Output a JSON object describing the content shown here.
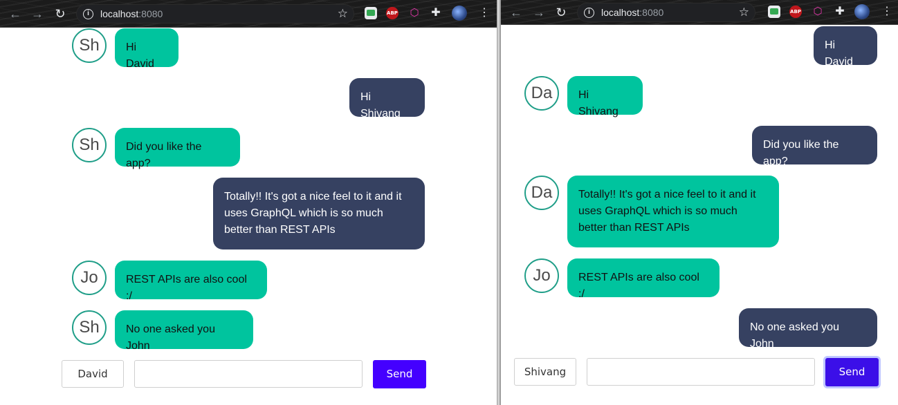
{
  "left_window": {
    "url_host": "localhost",
    "url_port": ":8080",
    "messages": [
      {
        "side": "them",
        "initials": "Sh",
        "text": "Hi David"
      },
      {
        "side": "me",
        "text": "Hi Shivang"
      },
      {
        "side": "them",
        "initials": "Sh",
        "text": "Did you like the app?"
      },
      {
        "side": "me",
        "text": "Totally!! It's got a nice feel to it and it uses GraphQL which is so much better than REST APIs"
      },
      {
        "side": "them",
        "initials": "Jo",
        "text": "REST APIs are also cool :/"
      },
      {
        "side": "them",
        "initials": "Sh",
        "text": "No one asked you John"
      }
    ],
    "composer": {
      "user_name": "David",
      "message_value": "",
      "send_label": "Send"
    }
  },
  "right_window": {
    "url_host": "localhost",
    "url_port": ":8080",
    "messages": [
      {
        "side": "me",
        "text": "Hi David"
      },
      {
        "side": "them",
        "initials": "Da",
        "text": "Hi Shivang"
      },
      {
        "side": "me",
        "text": "Did you like the app?"
      },
      {
        "side": "them",
        "initials": "Da",
        "text": "Totally!! It's got a nice feel to it and it uses GraphQL which is so much better than REST APIs"
      },
      {
        "side": "them",
        "initials": "Jo",
        "text": "REST APIs are also cool :/"
      },
      {
        "side": "me",
        "text": "No one asked you John"
      }
    ],
    "composer": {
      "user_name": "Shivang",
      "message_value": "",
      "send_label": "Send"
    }
  },
  "extensions": {
    "abp_label": "ABP"
  },
  "icons": [
    "back-arrow-icon",
    "forward-arrow-icon",
    "reload-icon",
    "info-icon",
    "star-icon",
    "mail-extension-icon",
    "adblock-icon",
    "graphql-extension-icon",
    "extensions-puzzle-icon",
    "profile-avatar-icon",
    "menu-kebab-icon"
  ],
  "colors": {
    "incoming_bubble": "#00c49e",
    "outgoing_bubble": "#364161",
    "send_button": "#4400ff",
    "avatar_ring": "#1f9e88"
  }
}
